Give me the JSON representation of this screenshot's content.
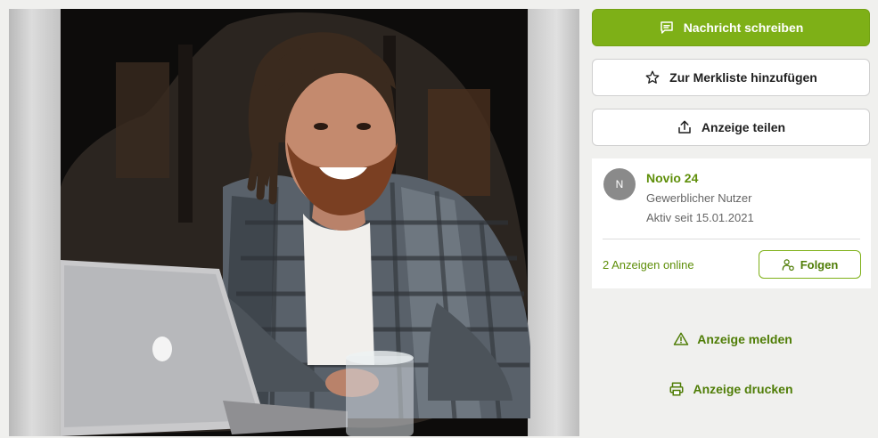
{
  "gallery": {
    "image_alt": "Portrait of a smiling man with dreadlocks and a beard, wearing a plaid shirt, sitting behind a laptop"
  },
  "actions": {
    "message_label": "Nachricht schreiben",
    "watchlist_label": "Zur Merkliste hinzufügen",
    "share_label": "Anzeige teilen"
  },
  "seller": {
    "avatar_initial": "N",
    "name": "Novio 24",
    "type": "Gewerblicher Nutzer",
    "active_since": "Aktiv seit 15.01.2021",
    "ads_online": "2 Anzeigen online",
    "follow_label": "Folgen"
  },
  "links": {
    "report_label": "Anzeige melden",
    "print_label": "Anzeige drucken"
  },
  "colors": {
    "accent": "#7eb017",
    "link": "#4f7d06",
    "background": "#f0f0ee"
  }
}
